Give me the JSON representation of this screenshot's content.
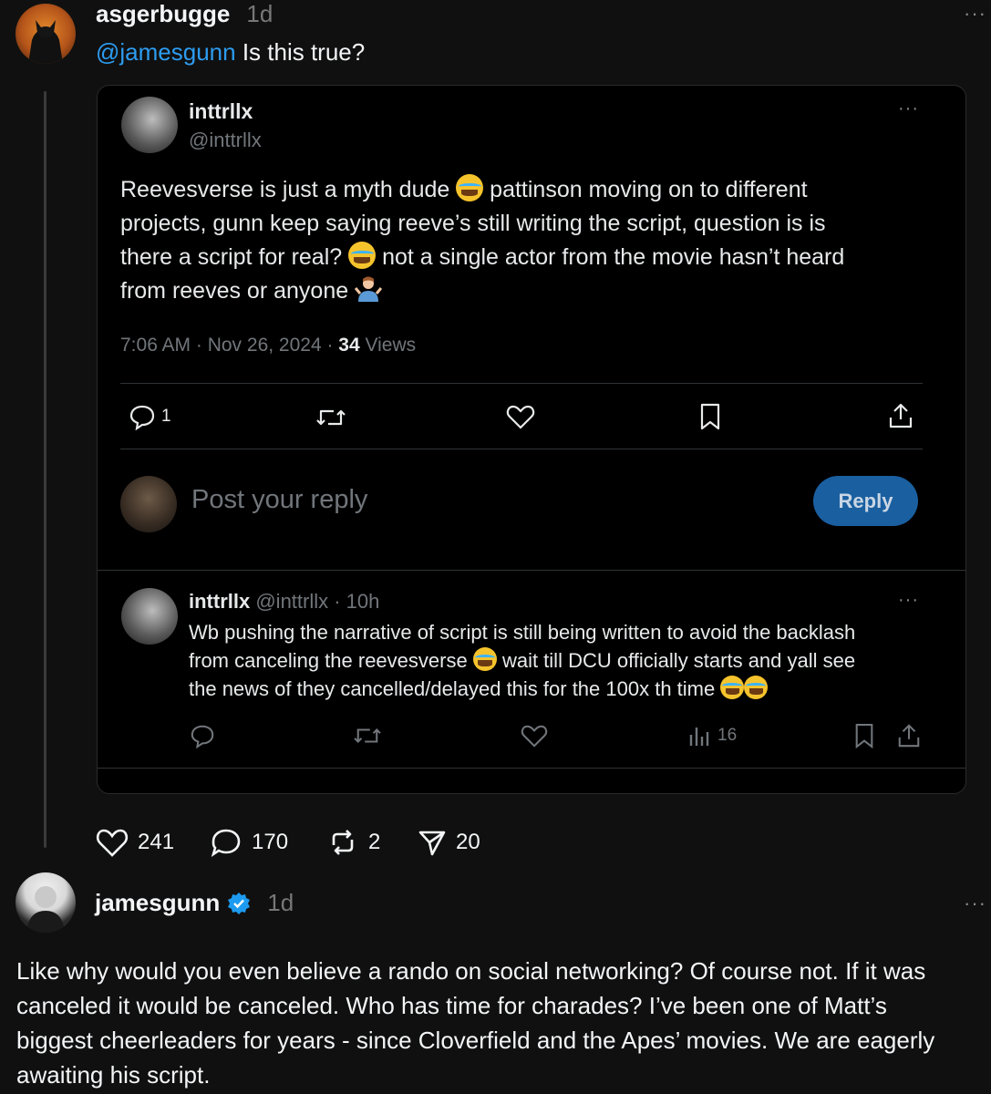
{
  "post": {
    "username": "asgerbugge",
    "time": "1d",
    "more": "···",
    "mention": "@jamesgunn",
    "text": " Is this true?",
    "actions": {
      "likes": "241",
      "comments": "170",
      "reposts": "2",
      "shares": "20"
    }
  },
  "embed": {
    "name": "inttrllx",
    "handle": "@inttrllx",
    "more": "···",
    "text": {
      "l1a": "Reevesverse is just a myth dude ",
      "l1b": " pattinson moving on to different",
      "l2": "projects, gunn keep saying reeve’s still writing the script, question is is",
      "l3a": "there a script for real? ",
      "l3b": " not a single actor from the movie hasn’t heard",
      "l4a": "from reeves or anyone "
    },
    "meta_time": "7:06 AM · Nov 26, 2024 · ",
    "meta_views_count": "34",
    "meta_views_label": " Views",
    "reply_count": "1",
    "reply_placeholder": "Post your reply",
    "reply_button": "Reply",
    "reply": {
      "name": "inttrllx",
      "handle_time": " @inttrllx · 10h",
      "more": "···",
      "l1": "Wb pushing the narrative of script is still being written to avoid the backlash",
      "l2a": "from canceling the reevesverse ",
      "l2b": " wait till DCU officially starts and yall see",
      "l3a": "the news of they cancelled/delayed this for the 100x th time ",
      "views": "16"
    }
  },
  "reply_post": {
    "username": "jamesgunn",
    "time": "1d",
    "more": "···",
    "l1": "Like why would you even believe a rando on social networking? Of course not. If it was",
    "l2": "canceled it would be canceled. Who has time for charades? I’ve been one of Matt’s",
    "l3": "biggest cheerleaders for years - since Cloverfield and the Apes’ movies. We are eagerly",
    "l4": "awaiting his script."
  },
  "colors": {
    "background": "#101010",
    "mention": "#2d9cf0",
    "verified": "#1d9bf0",
    "reply_button": "#1a5fa0"
  }
}
